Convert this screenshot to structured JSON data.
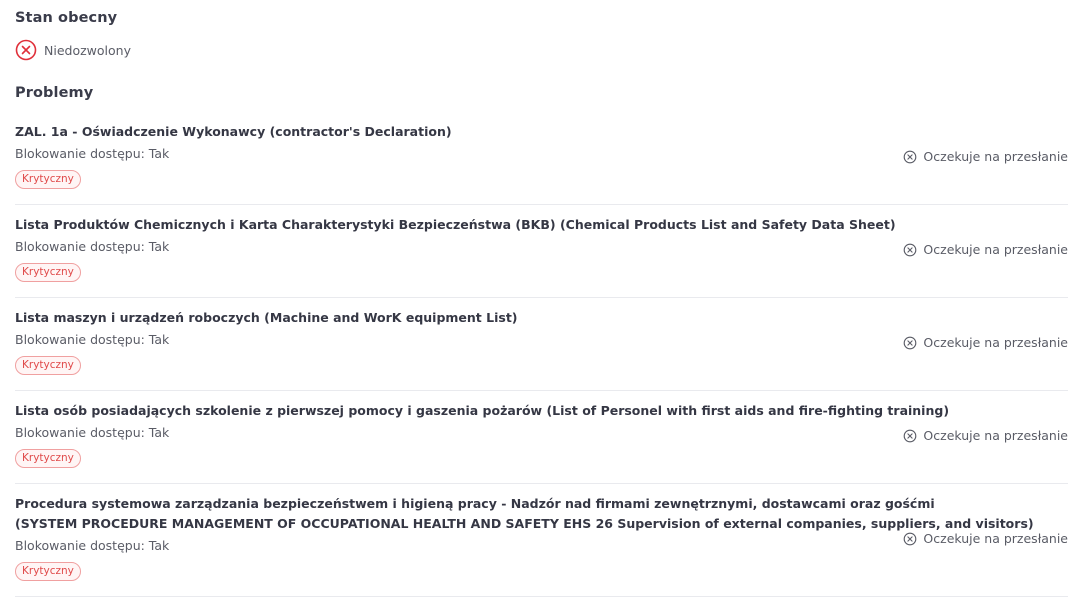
{
  "current_state": {
    "title": "Stan obecny",
    "value": "Niedozwolony",
    "icon": "x-circle-icon",
    "color": "#e0303a"
  },
  "problems": {
    "title": "Problemy",
    "items": [
      {
        "title_lines": [
          "ZAL. 1a - Oświadczenie Wykonawcy (contractor's Declaration)"
        ],
        "blocking": "Blokowanie dostępu: Tak",
        "badge": "Krytyczny",
        "status": "Oczekuje na przesłanie"
      },
      {
        "title_lines": [
          "Lista Produktów Chemicznych i Karta Charakterystyki Bezpieczeństwa (BKB) (Chemical Products List and Safety Data Sheet)"
        ],
        "blocking": "Blokowanie dostępu: Tak",
        "badge": "Krytyczny",
        "status": "Oczekuje na przesłanie"
      },
      {
        "title_lines": [
          "Lista maszyn i urządzeń roboczych (Machine and WorK equipment List)"
        ],
        "blocking": "Blokowanie dostępu: Tak",
        "badge": "Krytyczny",
        "status": "Oczekuje na przesłanie"
      },
      {
        "title_lines": [
          "Lista osób posiadających szkolenie z pierwszej pomocy i gaszenia pożarów (List of Personel with first aids and fire-fighting training)"
        ],
        "blocking": "Blokowanie dostępu: Tak",
        "badge": "Krytyczny",
        "status": "Oczekuje na przesłanie"
      },
      {
        "title_lines": [
          "Procedura systemowa zarządzania bezpieczeństwem i higieną pracy - Nadzór nad firmami zewnętrznymi, dostawcami oraz gośćmi",
          "(SYSTEM PROCEDURE MANAGEMENT OF OCCUPATIONAL HEALTH AND SAFETY EHS 26 Supervision of external companies, suppliers, and visitors)"
        ],
        "blocking": "Blokowanie dostępu: Tak",
        "badge": "Krytyczny",
        "status": "Oczekuje na przesłanie"
      }
    ]
  },
  "colors": {
    "critical_badge_text": "#e04a4a",
    "critical_badge_border": "#f0a0a0",
    "divider": "#e9eaee"
  }
}
